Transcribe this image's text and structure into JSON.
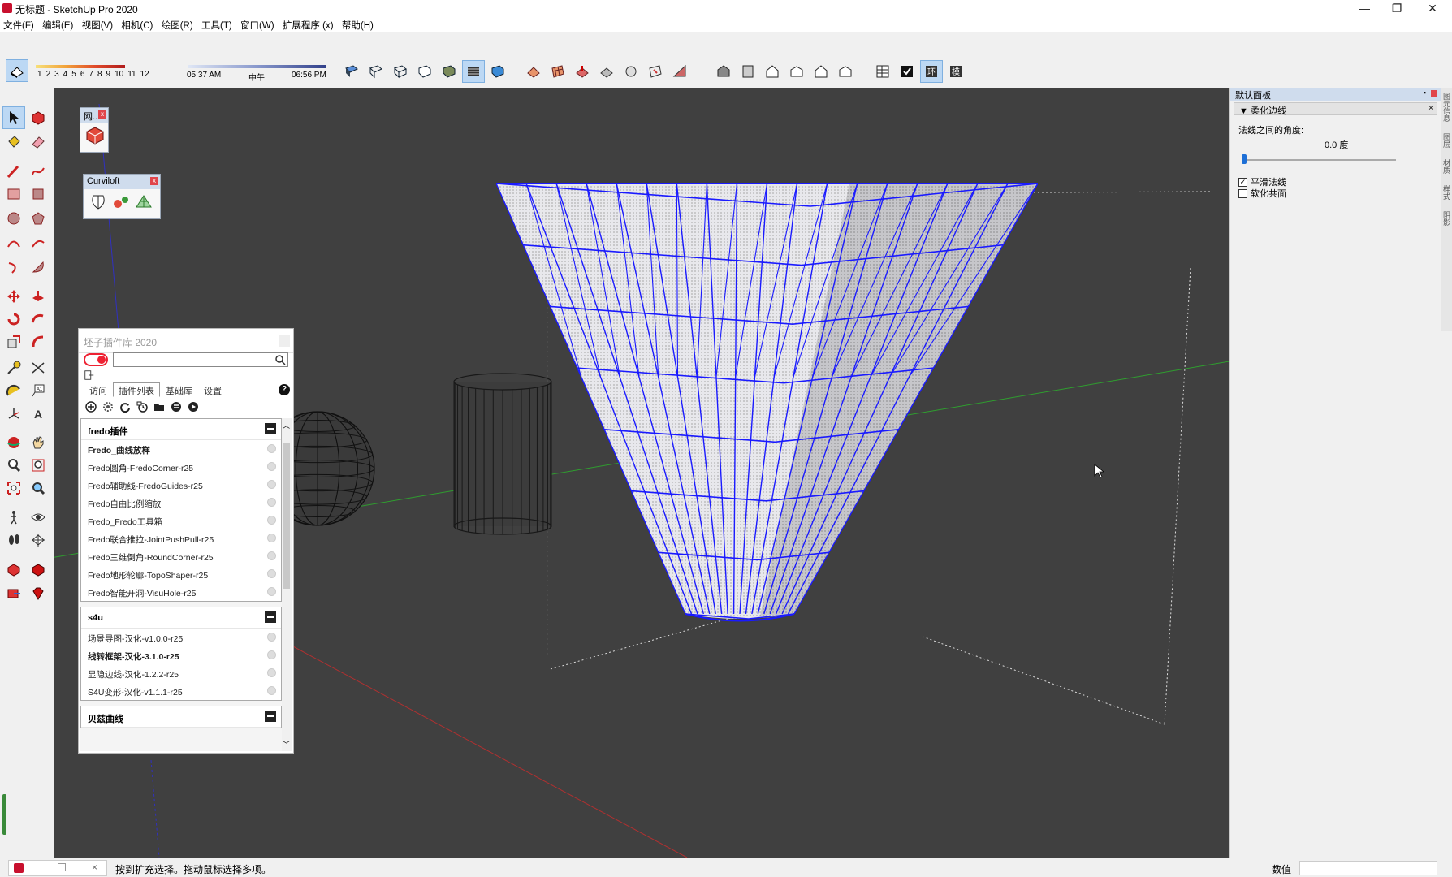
{
  "window": {
    "title": "无标题 - SketchUp Pro 2020",
    "minimize": "—",
    "restore": "❐",
    "close": "✕"
  },
  "menu": [
    "文件(F)",
    "编辑(E)",
    "视图(V)",
    "相机(C)",
    "绘图(R)",
    "工具(T)",
    "窗口(W)",
    "扩展程序 (x)",
    "帮助(H)"
  ],
  "shadow_settings": {
    "month_numbers": [
      "1",
      "2",
      "3",
      "4",
      "5",
      "6",
      "7",
      "8",
      "9",
      "10",
      "11",
      "12"
    ],
    "sunrise": "05:37 AM",
    "noon": "中午",
    "sunset": "06:56 PM"
  },
  "floating_toolbars": {
    "net": {
      "title": "网..."
    },
    "curviloft": {
      "title": "Curviloft"
    }
  },
  "plugin_panel": {
    "title": "坯子插件库 2020",
    "search_placeholder": "",
    "tabs": [
      "访问",
      "插件列表",
      "基础库",
      "设置"
    ],
    "active_tab": "插件列表",
    "help": "?",
    "groups": [
      {
        "name": "fredo插件",
        "items": [
          {
            "label": "Fredo_曲线放样",
            "bold": true
          },
          {
            "label": "Fredo圆角-FredoCorner-r25",
            "bold": false
          },
          {
            "label": "Fredo辅助线-FredoGuides-r25",
            "bold": false
          },
          {
            "label": "Fredo自由比例缩放",
            "bold": false
          },
          {
            "label": "Fredo_Fredo工具箱",
            "bold": false
          },
          {
            "label": "Fredo联合推拉-JointPushPull-r25",
            "bold": false
          },
          {
            "label": "Fredo三维倒角-RoundCorner-r25",
            "bold": false
          },
          {
            "label": "Fredo地形轮廓-TopoShaper-r25",
            "bold": false
          },
          {
            "label": "Fredo智能开洞-VisuHole-r25",
            "bold": false
          }
        ]
      },
      {
        "name": "s4u",
        "items": [
          {
            "label": "场景导图-汉化-v1.0.0-r25",
            "bold": false
          },
          {
            "label": "线转框架-汉化-3.1.0-r25",
            "bold": true
          },
          {
            "label": "显隐边线-汉化-1.2.2-r25",
            "bold": false
          },
          {
            "label": "S4U变形-汉化-v1.1.1-r25",
            "bold": false
          }
        ]
      },
      {
        "name": "贝兹曲线",
        "items": []
      }
    ]
  },
  "tray": {
    "title": "默认面板",
    "section": "柔化边线",
    "angle_label": "法线之间的角度:",
    "angle_value": "0.0",
    "angle_unit": "度",
    "angle_fraction": 0.0,
    "checkboxes": [
      {
        "label": "平滑法线",
        "checked": true
      },
      {
        "label": "软化共面",
        "checked": false
      }
    ],
    "side_tabs": [
      "图元信息",
      "图层",
      "材质",
      "样式",
      "阴影"
    ]
  },
  "status": {
    "message": "按到扩充选择。拖动鼠标选择多项。",
    "vcb_label": "数值",
    "vcb_value": ""
  },
  "colors": {
    "viewport_bg": "#404040",
    "wire": "#1a1aff",
    "accent": "#c8102e",
    "green_axis": "#2f9e2f",
    "red_axis": "#b03030",
    "blue_axis": "#3030c0"
  }
}
